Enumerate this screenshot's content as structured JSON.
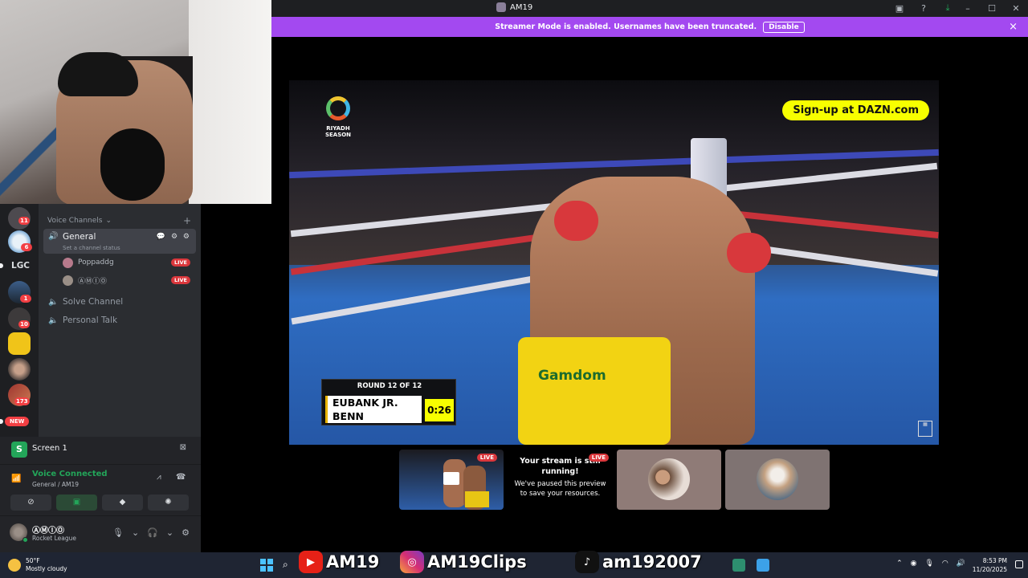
{
  "window": {
    "title": "AM19",
    "title_icon": "user-avatar-icon",
    "tools": [
      "screen-icon",
      "help-icon",
      "download-icon"
    ],
    "controls": [
      "minimize-icon",
      "maximize-icon",
      "close-icon"
    ]
  },
  "streamer_banner": {
    "message": "Streamer Mode is enabled. Usernames have been truncated.",
    "button": "Disable",
    "close": "×",
    "color": "#a349f0"
  },
  "stream": {
    "sponsor_cta": "Sign-up at DAZN.com",
    "logo_line1": "RIYADH",
    "logo_line2": "SEASON",
    "trunks_brand": "Gamdom",
    "scorebox": {
      "round": "ROUND 12 OF 12",
      "fighter1": "EUBANK JR.",
      "fighter2": "BENN",
      "clock": "0:26"
    }
  },
  "tiles": {
    "preview_live": "LIVE",
    "note_title": "Your stream is still running!",
    "note_body": "We've paused this preview to save your resources.",
    "note_live": "LIVE"
  },
  "rail": {
    "badges": [
      "11",
      "6",
      "1",
      "10",
      "173"
    ],
    "text_server": "LGC",
    "new_pill": "NEW"
  },
  "channels": {
    "category": "Voice Channels",
    "category_chevron": "⌄",
    "add": "+",
    "active": {
      "name": "General",
      "status_placeholder": "Set a channel status",
      "actions": "💬 ⚙ ⚙"
    },
    "voice_users": [
      {
        "name": "Poppaddg",
        "live": "LIVE"
      },
      {
        "name": "ⒶⓂⒾⓄ",
        "live": "LIVE"
      }
    ],
    "others": [
      "Solve Channel",
      "Personal Talk"
    ]
  },
  "screen_panel": {
    "label": "Screen 1",
    "icon_letter": "S"
  },
  "voice_panel": {
    "status": "Voice Connected",
    "sub": "General / AM19",
    "accent": "#23a559"
  },
  "user_panel": {
    "name": "ⒶⓂⒾⓄ",
    "activity": "Rocket League"
  },
  "taskbar": {
    "temp": "50°F",
    "weather": "Mostly cloudy",
    "social_youtube": "AM19",
    "social_instagram": "AM19Clips",
    "social_tiktok": "am192007",
    "time": "8:53 PM",
    "date": "11/20/2025"
  }
}
